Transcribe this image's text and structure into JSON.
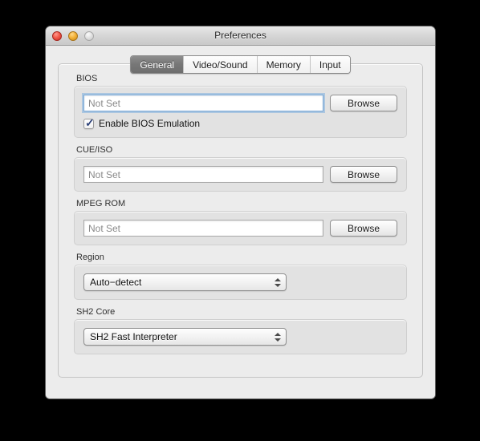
{
  "window": {
    "title": "Preferences",
    "controls": [
      {
        "name": "close",
        "label": "Close"
      },
      {
        "name": "minimize",
        "label": "Minimize"
      },
      {
        "name": "zoom",
        "label": "Zoom"
      }
    ]
  },
  "tabs": [
    {
      "label": "General",
      "selected": true
    },
    {
      "label": "Video/Sound",
      "selected": false
    },
    {
      "label": "Memory",
      "selected": false
    },
    {
      "label": "Input",
      "selected": false
    }
  ],
  "sections": {
    "bios": {
      "label": "BIOS",
      "field": {
        "value": "",
        "placeholder": "Not Set",
        "focused": true
      },
      "browse_label": "Browse",
      "checkbox": {
        "label": "Enable BIOS Emulation",
        "checked": true,
        "mark": "✓"
      }
    },
    "cueiso": {
      "label": "CUE/ISO",
      "field": {
        "value": "",
        "placeholder": "Not Set",
        "focused": false
      },
      "browse_label": "Browse"
    },
    "mpegrom": {
      "label": "MPEG ROM",
      "field": {
        "value": "",
        "placeholder": "Not Set",
        "focused": false
      },
      "browse_label": "Browse"
    },
    "region": {
      "label": "Region",
      "select": {
        "value": "Auto−detect"
      }
    },
    "sh2core": {
      "label": "SH2 Core",
      "select": {
        "value": "SH2 Fast Interpreter"
      }
    }
  },
  "colors": {
    "window_bg": "#ececec",
    "groupbox_bg": "#e2e2e2",
    "selected_tab_bg": "#777777",
    "focus_ring": "#7aa9d8",
    "checkmark": "#2a3f77",
    "desktop_bg": "#000000"
  }
}
